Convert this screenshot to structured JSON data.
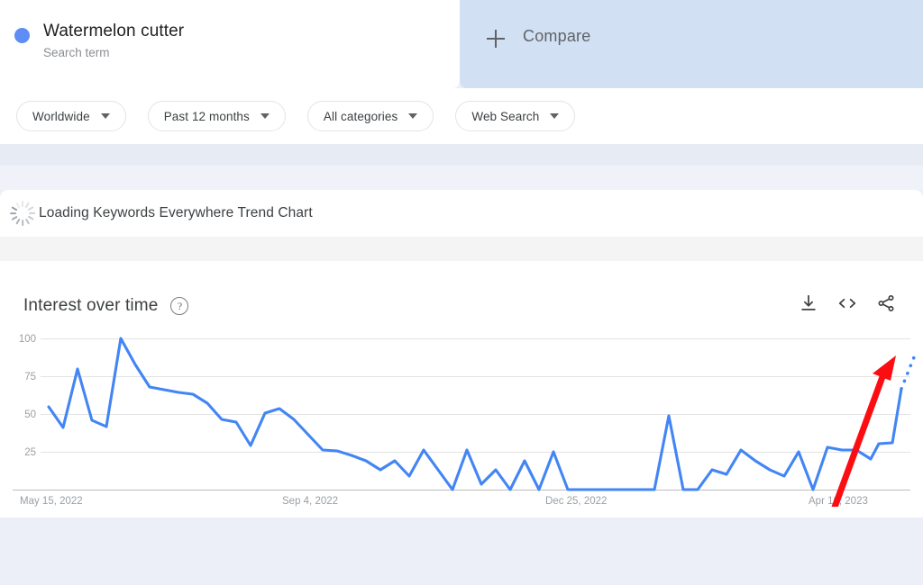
{
  "search_term": {
    "name": "Watermelon cutter",
    "type_label": "Search term",
    "dot_color": "#5e8df5"
  },
  "compare": {
    "label": "Compare",
    "icon": "plus-icon",
    "background": "#d2e0f3"
  },
  "filters": [
    {
      "label": "Worldwide"
    },
    {
      "label": "Past 12 months"
    },
    {
      "label": "All categories"
    },
    {
      "label": "Web Search"
    }
  ],
  "loading": {
    "text": "Loading Keywords Everywhere Trend Chart",
    "icon": "spinner-icon"
  },
  "chart_panel": {
    "title": "Interest over time",
    "help_icon": "question-mark-icon",
    "help_glyph": "?",
    "actions": [
      {
        "name": "download-icon"
      },
      {
        "name": "embed-code-icon"
      },
      {
        "name": "share-icon"
      }
    ]
  },
  "annotation": {
    "type": "arrow",
    "color": "#fc0d11",
    "direction": "up-right"
  },
  "chart_data": {
    "type": "line",
    "title": "Interest over time",
    "xlabel": "",
    "ylabel": "",
    "ylim": [
      0,
      100
    ],
    "yticks": [
      25,
      50,
      75,
      100
    ],
    "ytick_labels": [
      "25",
      "50",
      "75",
      "100"
    ],
    "grid": true,
    "legend": false,
    "line_color": "#4285f4",
    "xtick_labels": [
      "May 15, 2022",
      "Sep 4, 2022",
      "Dec 25, 2022",
      "Apr 16, 2023"
    ],
    "xtick_positions": [
      0,
      16,
      32,
      48
    ],
    "series": [
      {
        "name": "Watermelon cutter",
        "values": [
          55,
          41,
          80,
          54,
          48,
          100,
          83,
          68,
          66,
          64,
          63,
          57,
          46,
          44,
          30,
          51,
          54,
          46,
          36,
          26,
          25,
          22,
          19,
          13,
          19,
          9,
          26,
          13,
          0,
          26,
          4,
          13,
          0,
          19,
          0,
          25,
          0,
          0,
          0,
          0,
          0,
          0,
          0,
          49,
          0,
          0,
          13,
          10,
          26,
          19,
          13,
          9,
          25,
          0,
          28,
          26,
          26,
          20,
          30,
          30,
          67
        ]
      }
    ],
    "partial_data_segment": {
      "style": "dotted",
      "values": [
        67,
        80
      ]
    },
    "peak_value": 100,
    "final_value": 67
  }
}
